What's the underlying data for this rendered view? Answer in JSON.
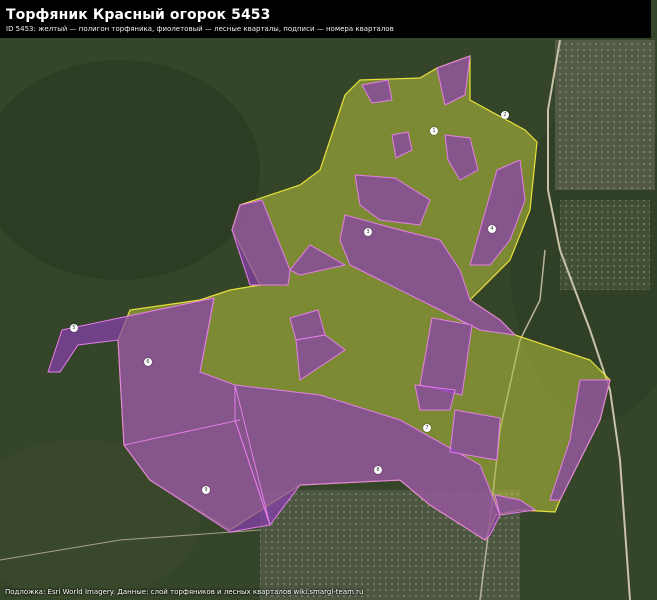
{
  "map": {
    "title": "Торфяник Красный огорок 5453",
    "subtitle": "ID 5453: желтый — полигон торфяника, фиолетовый — лесные кварталы, подписи — номера кварталов",
    "attribution": "Подложка: Esri World Imagery. Данные: слой торфяников и лесных кварталов wiki.smargl-team.ru",
    "colors": {
      "peatland_fill": "#b8c23a",
      "peatland_outline": "#e8e23c",
      "forest_quarter_fill": "#8a3fb0",
      "forest_quarter_outline": "#e67ee8",
      "header_bg": "#000000"
    },
    "quarter_labels": [
      {
        "id": "q-a",
        "text": "1"
      },
      {
        "id": "q-b",
        "text": "2"
      },
      {
        "id": "q-c",
        "text": "3"
      },
      {
        "id": "q-d",
        "text": "4"
      },
      {
        "id": "q-e",
        "text": "5"
      },
      {
        "id": "q-f",
        "text": "6"
      },
      {
        "id": "q-g",
        "text": "7"
      },
      {
        "id": "q-h",
        "text": "8"
      },
      {
        "id": "q-i",
        "text": "9"
      }
    ]
  }
}
